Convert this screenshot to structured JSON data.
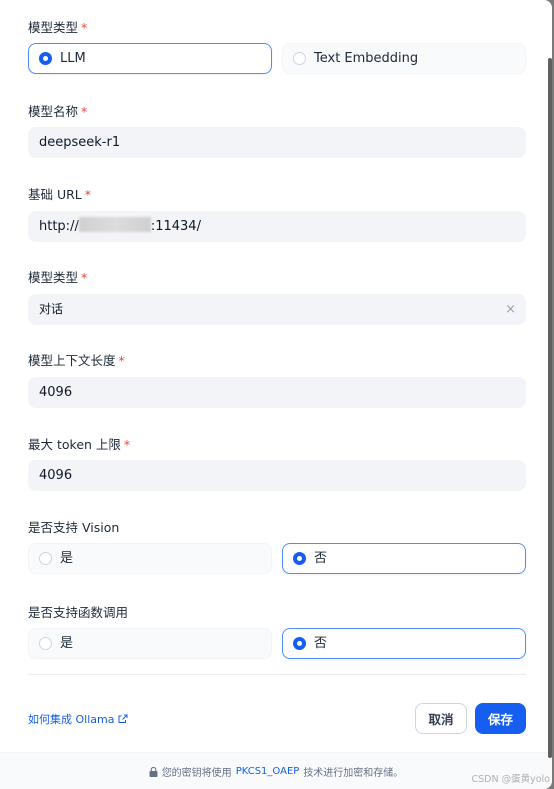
{
  "form": {
    "model_type": {
      "label": "模型类型",
      "required": "*",
      "options": [
        {
          "label": "LLM",
          "selected": true
        },
        {
          "label": "Text Embedding",
          "selected": false
        }
      ]
    },
    "model_name": {
      "label": "模型名称",
      "required": "*",
      "value": "deepseek-r1"
    },
    "base_url": {
      "label": "基础 URL",
      "required": "*",
      "value_prefix": "http://",
      "value_suffix": ":11434/"
    },
    "model_kind": {
      "label": "模型类型",
      "required": "*",
      "value": "对话",
      "clear": "×"
    },
    "context_length": {
      "label": "模型上下文长度",
      "required": "*",
      "value": "4096"
    },
    "max_tokens": {
      "label": "最大 token 上限",
      "required": "*",
      "value": "4096"
    },
    "vision": {
      "label": "是否支持 Vision",
      "options": [
        {
          "label": "是",
          "selected": false
        },
        {
          "label": "否",
          "selected": true
        }
      ]
    },
    "function_call": {
      "label": "是否支持函数调用",
      "options": [
        {
          "label": "是",
          "selected": false
        },
        {
          "label": "否",
          "selected": true
        }
      ]
    }
  },
  "actions": {
    "help_link": "如何集成 Ollama",
    "cancel_label": "取消",
    "save_label": "保存"
  },
  "footer": {
    "text_before": "您的密钥将使用",
    "highlight": "PKCS1_OAEP",
    "text_after": "技术进行加密和存储。"
  },
  "watermark": "CSDN @蛋黄yolo",
  "colors": {
    "accent": "#155eef",
    "required": "#f04438"
  },
  "icons": {
    "footer": "lock-icon",
    "link": "external-link-icon"
  }
}
